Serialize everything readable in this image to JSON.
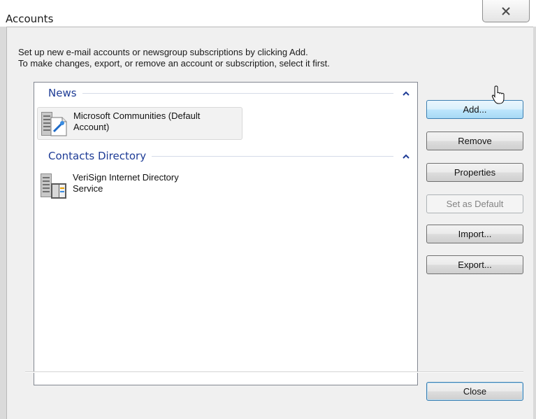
{
  "window": {
    "title": "Accounts",
    "close_glyph": "✕"
  },
  "description": {
    "line1": "Set up new e-mail accounts or newsgroup subscriptions by clicking Add.",
    "line2": "To make changes, export, or remove an account or subscription, select it first."
  },
  "groups": [
    {
      "title": "News",
      "items": [
        {
          "label_line1": "Microsoft Communities (Default",
          "label_line2": "Account)",
          "icon": "news-server-icon",
          "selected": true
        }
      ]
    },
    {
      "title": "Contacts Directory",
      "items": [
        {
          "label_line1": "VeriSign Internet Directory",
          "label_line2": "Service",
          "icon": "directory-service-icon",
          "selected": false
        }
      ]
    }
  ],
  "buttons": {
    "add": "Add...",
    "remove": "Remove",
    "properties": "Properties",
    "set_default": "Set as Default",
    "import": "Import...",
    "export": "Export...",
    "close": "Close"
  },
  "colors": {
    "group_title": "#1e3c96",
    "hot_button": "#bee6fd",
    "client_bg": "#f0f0f0"
  }
}
